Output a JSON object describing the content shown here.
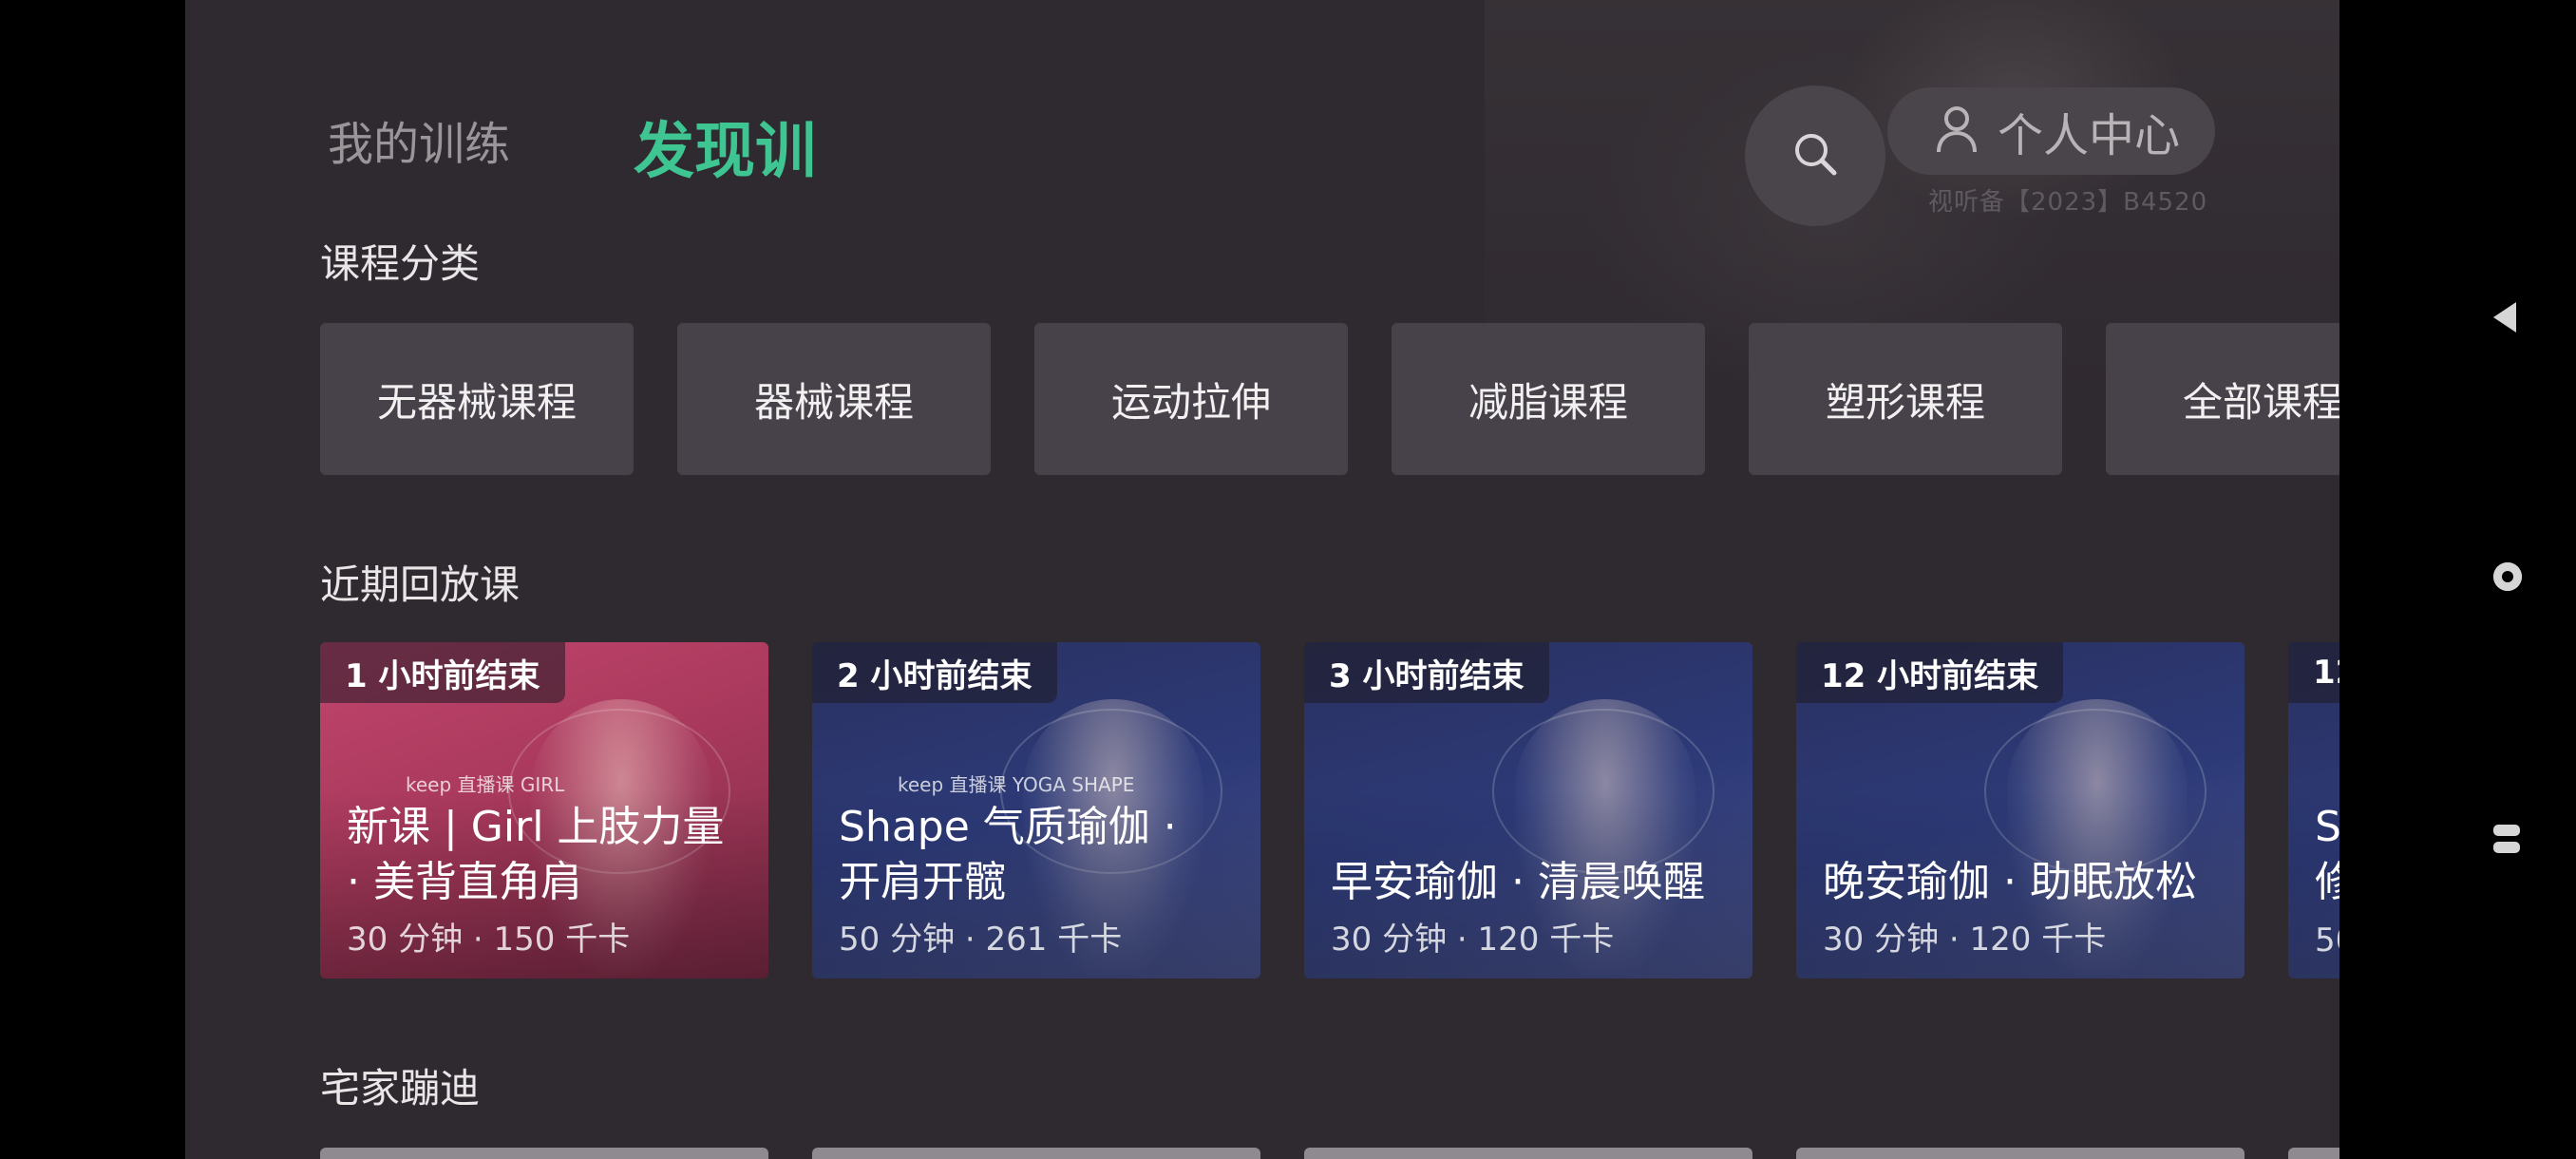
{
  "header": {
    "tab_mine": "我的训练",
    "tab_discover": "发现训",
    "profile_label": "个人中心",
    "license": "视听备【2023】B4520"
  },
  "categories": {
    "title": "课程分类",
    "items": [
      "无器械课程",
      "器械课程",
      "运动拉伸",
      "减脂课程",
      "塑形课程",
      "全部课程"
    ]
  },
  "replay": {
    "title": "近期回放课",
    "cards": [
      {
        "badge": "1 小时前结束",
        "title": "新课 | Girl 上肢力量\n· 美背直角肩",
        "meta": "30 分钟 · 150 千卡",
        "logo": "keep 直播课 GIRL"
      },
      {
        "badge": "2 小时前结束",
        "title": "Shape 气质瑜伽 ·\n开肩开髋",
        "meta": "50 分钟 · 261 千卡",
        "logo": "keep 直播课 YOGA SHAPE"
      },
      {
        "badge": "3 小时前结束",
        "title": "早安瑜伽 · 清晨唤醒",
        "meta": "30 分钟 · 120 千卡",
        "logo": ""
      },
      {
        "badge": "12 小时前结束",
        "title": "晚安瑜伽 · 助眠放松",
        "meta": "30 分钟 · 120 千卡",
        "logo": ""
      },
      {
        "badge": "12",
        "title": "S\n修",
        "meta": "50",
        "logo": ""
      }
    ]
  },
  "home_disco": {
    "title": "宅家蹦迪"
  },
  "icons": {
    "search": "search-icon",
    "profile": "user-icon",
    "nav_back": "back-icon",
    "nav_home": "home-icon",
    "nav_recent": "recent-apps-icon"
  },
  "colors": {
    "accent": "#3ec592",
    "background": "#2f2a30"
  }
}
